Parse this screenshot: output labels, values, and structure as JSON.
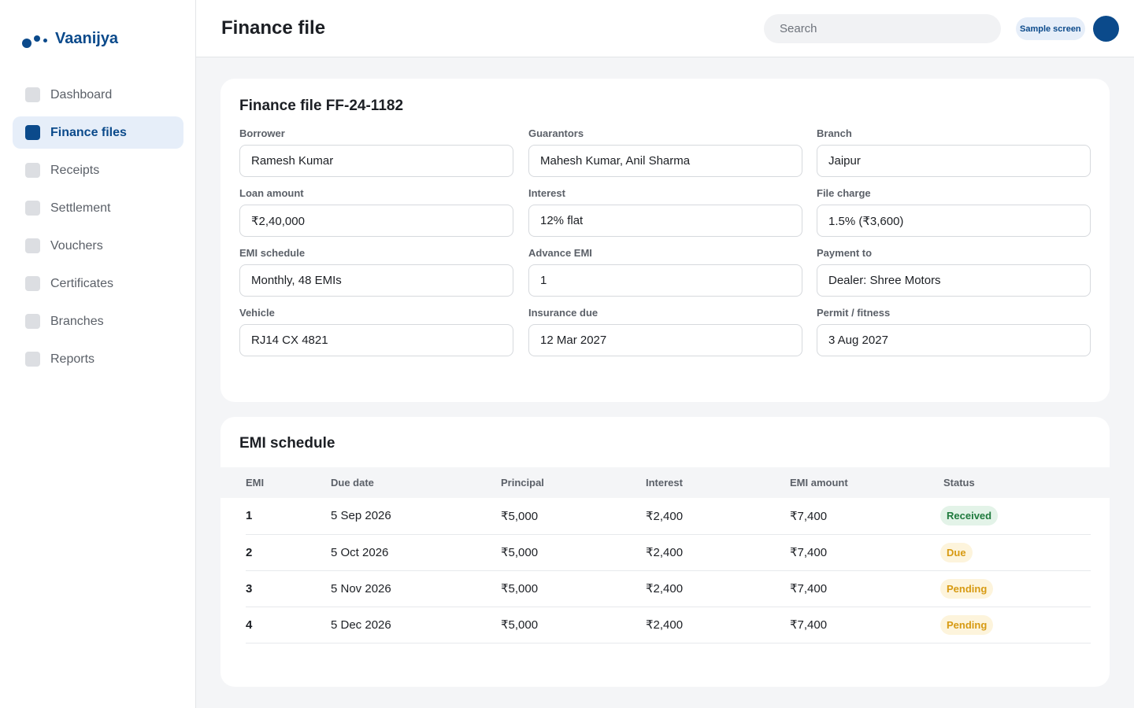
{
  "brand": {
    "name": "Vaanijya",
    "color": "#0b4a8b"
  },
  "sidebar": {
    "items": [
      {
        "label": "Dashboard",
        "active": false
      },
      {
        "label": "Finance files",
        "active": true
      },
      {
        "label": "Receipts",
        "active": false
      },
      {
        "label": "Settlement",
        "active": false
      },
      {
        "label": "Vouchers",
        "active": false
      },
      {
        "label": "Certificates",
        "active": false
      },
      {
        "label": "Branches",
        "active": false
      },
      {
        "label": "Reports",
        "active": false
      }
    ]
  },
  "header": {
    "title": "Finance file",
    "search_placeholder": "Search",
    "badge": "Sample screen"
  },
  "file": {
    "title": "Finance file FF-24-1182",
    "fields": {
      "borrower": {
        "label": "Borrower",
        "value": "Ramesh Kumar"
      },
      "guarantors": {
        "label": "Guarantors",
        "value": "Mahesh Kumar, Anil Sharma"
      },
      "branch": {
        "label": "Branch",
        "value": "Jaipur"
      },
      "loan_amount": {
        "label": "Loan amount",
        "value": "₹2,40,000"
      },
      "interest": {
        "label": "Interest",
        "value": "12% flat"
      },
      "file_charge": {
        "label": "File charge",
        "value": "1.5% (₹3,600)"
      },
      "emi_schedule": {
        "label": "EMI schedule",
        "value": "Monthly, 48 EMIs"
      },
      "advance_emi": {
        "label": "Advance EMI",
        "value": "1"
      },
      "payment_to": {
        "label": "Payment to",
        "value": "Dealer: Shree Motors"
      },
      "vehicle": {
        "label": "Vehicle",
        "value": "RJ14 CX 4821"
      },
      "insurance_due": {
        "label": "Insurance due",
        "value": "12 Mar 2027"
      },
      "permit_fitness": {
        "label": "Permit / fitness",
        "value": "3 Aug 2027"
      }
    }
  },
  "emi": {
    "title": "EMI schedule",
    "columns": {
      "emi": "EMI",
      "due_date": "Due date",
      "principal": "Principal",
      "interest": "Interest",
      "emi_amount": "EMI amount",
      "status": "Status"
    },
    "rows": [
      {
        "emi": "1",
        "due_date": "5 Sep 2026",
        "principal": "₹5,000",
        "interest": "₹2,400",
        "emi_amount": "₹7,400",
        "status": "Received"
      },
      {
        "emi": "2",
        "due_date": "5 Oct 2026",
        "principal": "₹5,000",
        "interest": "₹2,400",
        "emi_amount": "₹7,400",
        "status": "Due"
      },
      {
        "emi": "3",
        "due_date": "5 Nov 2026",
        "principal": "₹5,000",
        "interest": "₹2,400",
        "emi_amount": "₹7,400",
        "status": "Pending"
      },
      {
        "emi": "4",
        "due_date": "5 Dec 2026",
        "principal": "₹5,000",
        "interest": "₹2,400",
        "emi_amount": "₹7,400",
        "status": "Pending"
      }
    ],
    "status_colors": {
      "Received": "#1f7a3d",
      "Due": "#d79a12",
      "Pending": "#d79a12"
    }
  }
}
